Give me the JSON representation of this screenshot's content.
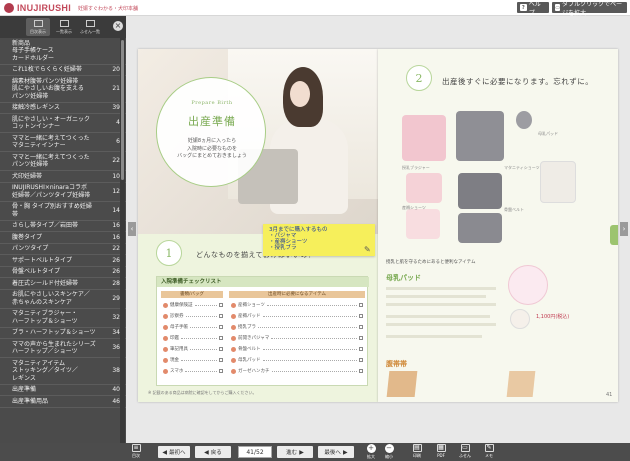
{
  "header": {
    "logo": "INUJIRUSHI",
    "logo_sub": "妊娠すぐわかる・犬印本舗",
    "help_label": "ヘルプ",
    "double_click_label": "ダブルクリックでページを拡大"
  },
  "sidebar": {
    "tabs": [
      "目次表示",
      "一覧表示",
      "ふせん一覧"
    ],
    "items": [
      {
        "label": "新商品\n母子手帳ケース\nカードホルダー",
        "page": ""
      },
      {
        "label": "これ1枚でらくらく妊婦帯",
        "page": "20"
      },
      {
        "label": "綿素材腹帯パンツ妊婦帯\n肌にやさしいお腹を支える\nパンツ妊婦帯",
        "page": "21"
      },
      {
        "label": "接触冷感レギンス",
        "page": "39"
      },
      {
        "label": "肌にやさしい・オーガニック\nコットンインナー",
        "page": "4"
      },
      {
        "label": "ママと一緒に考えてつくった\nマタニティインナー",
        "page": "6"
      },
      {
        "label": "ママと一緒に考えてつくった\nパンツ妊婦帯",
        "page": "22"
      },
      {
        "label": "犬印妊婦帯",
        "page": "10"
      },
      {
        "label": "INUJIRUSHI×ninaraコラボ\n妊婦帯／パンツタイプ妊婦帯",
        "page": "12"
      },
      {
        "label": "骨・胸 タイプ別おすすめ妊婦\n帯",
        "page": "14"
      },
      {
        "label": "さらし帯タイプ／岩田帯",
        "page": "16"
      },
      {
        "label": "腹巻タイプ",
        "page": "16"
      },
      {
        "label": "パンツタイプ",
        "page": "22"
      },
      {
        "label": "サポートベルトタイプ",
        "page": "26"
      },
      {
        "label": "骨盤ベルトタイプ",
        "page": "26"
      },
      {
        "label": "着圧式シールド付妊婦帯",
        "page": "28"
      },
      {
        "label": "お肌にやさしいスキンケア／\n赤ちゃんのスキンケア",
        "page": "29"
      },
      {
        "label": "マタニティブラジャー・\nハーフトップ＆ショーツ",
        "page": "32"
      },
      {
        "label": "ブラ・ハーフトップ＆ショーツ",
        "page": "34"
      },
      {
        "label": "ママの声から生まれたシリーズ\nハーフトップ／ショーツ",
        "page": "36"
      },
      {
        "label": "マタニティアイテム\nストッキング／タイツ／\nレギンス",
        "page": "38"
      },
      {
        "label": "出産準備",
        "page": "40"
      },
      {
        "label": "出産準備用品",
        "page": "46"
      }
    ]
  },
  "left_page": {
    "circle_en": "Prepare Birth",
    "circle_title": "出産準備",
    "circle_text": "妊娠8ヵ月に入ったら\n入院時に必要なものを\nバッグにまとめておきましょう",
    "sticky_text": "3月までに購入するもの\n・パジャマ\n・産褥ショーツ\n・授乳ブラ",
    "step_number": "1",
    "step_heading": "どんなものを揃えておけばいいの？",
    "checklist_title": "入院準備チェックリスト",
    "col_head_1": "書類/バッグ",
    "col_head_2": "出産時に必要になるアイテム",
    "rows_left": [
      "健康保険証",
      "診察券",
      "母子手帳",
      "印鑑",
      "筆記用具",
      "現金",
      "スマホ"
    ],
    "rows_right": [
      "産褥ショーツ",
      "産褥パッド",
      "授乳ブラ",
      "前開きパジャマ",
      "骨盤ベルト",
      "母乳パッド",
      "ガーゼハンカチ"
    ],
    "footnote": "※ 記載のある商品は病院に確認をしてからご購入ください。",
    "page_number": "40"
  },
  "right_page": {
    "step_number": "2",
    "step_heading": "出産後すぐに必要になります。忘れずに。",
    "products": [
      "授乳ブラジャー",
      "マタニティショーツ",
      "産褥ショーツ",
      "骨盤ベルト",
      "母乳パッド"
    ],
    "lower_title": "授乳と肌を守るためにあると便利なアイテム",
    "lower_green": "母乳パッド",
    "price": "1,100円(税込)",
    "lower2_green": "腹帯帯",
    "page_number": "41"
  },
  "toolbar": {
    "toc_label": "目次",
    "first_label": "最初へ",
    "prev_label": "戻る",
    "page_value": "41/52",
    "next_label": "進む",
    "last_label": "最後へ",
    "zoom_in": "拡大",
    "zoom_out": "縮小",
    "print": "印刷",
    "pdf": "PDF",
    "sticky": "ふせん",
    "memo": "メモ"
  }
}
